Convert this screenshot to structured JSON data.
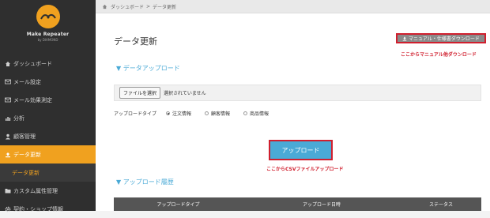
{
  "sidebar": {
    "logo_title": "Make Repeater",
    "logo_sub": "by DIAMOND",
    "items": [
      {
        "label": "ダッシュボード",
        "icon": "home-icon"
      },
      {
        "label": "メール設定",
        "icon": "envelope-icon"
      },
      {
        "label": "メール効果測定",
        "icon": "envelope-icon"
      },
      {
        "label": "分析",
        "icon": "bar-chart-icon"
      },
      {
        "label": "顧客管理",
        "icon": "user-icon"
      },
      {
        "label": "データ更新",
        "icon": "upload-icon"
      },
      {
        "label": "データ更新"
      },
      {
        "label": "カスタム属性管理",
        "icon": "folder-icon"
      },
      {
        "label": "契約・ショップ情報",
        "icon": "gear-icon"
      }
    ],
    "accent_color": "#f0a11f"
  },
  "breadcrumb": {
    "home": "ダッシュボード",
    "separator": ">",
    "current": "データ更新"
  },
  "page": {
    "title": "データ更新",
    "manual_button": "マニュアル・仕様書ダウンロード",
    "manual_note": "ここからマニュアル他ダウンロード"
  },
  "upload": {
    "section_title": "データアップロード",
    "file_button": "ファイルを選択",
    "file_status": "選択されていません",
    "type_label": "アップロードタイプ",
    "types": [
      "注文情報",
      "顧客情報",
      "商品情報"
    ],
    "selected_type": "注文情報",
    "upload_button": "アップロード",
    "upload_note": "ここからCSVファイルアップロード"
  },
  "history": {
    "section_title": "アップロード履歴",
    "columns": [
      "アップロードタイプ",
      "アップロード日時",
      "ステータス"
    ]
  },
  "colors": {
    "primary": "#4aaad6",
    "highlight": "#d01f2e"
  }
}
